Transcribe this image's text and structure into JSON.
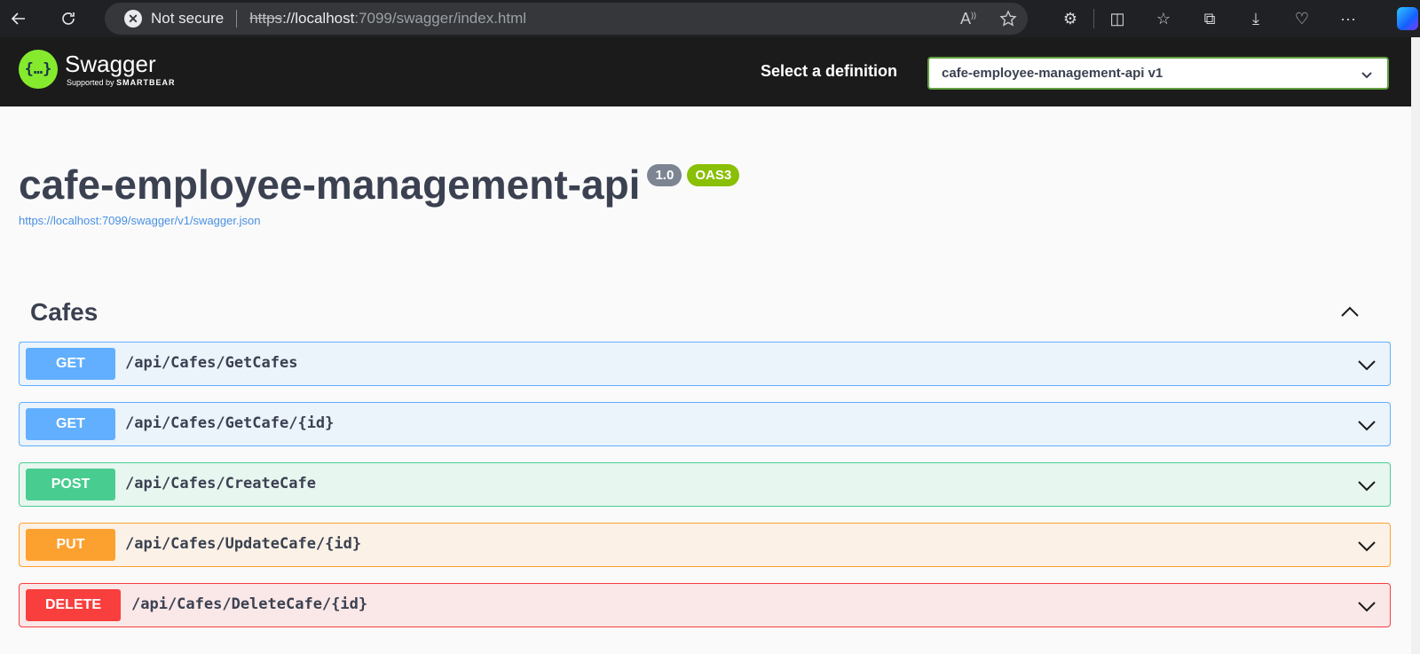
{
  "browser": {
    "security_label": "Not secure",
    "url_scheme": "https",
    "url_host": "://localhost",
    "url_rest": ":7099/swagger/index.html"
  },
  "topbar": {
    "logo_title": "Swagger",
    "logo_supported": "Supported by",
    "logo_brand": "SMARTBEAR",
    "definition_label": "Select a definition",
    "definition_selected": "cafe-employee-management-api v1"
  },
  "info": {
    "title": "cafe-employee-management-api",
    "version": "1.0",
    "oas_badge": "OAS3",
    "spec_url": "https://localhost:7099/swagger/v1/swagger.json"
  },
  "tag": {
    "name": "Cafes"
  },
  "operations": [
    {
      "method": "GET",
      "path": "/api/Cafes/GetCafes"
    },
    {
      "method": "GET",
      "path": "/api/Cafes/GetCafe/{id}"
    },
    {
      "method": "POST",
      "path": "/api/Cafes/CreateCafe"
    },
    {
      "method": "PUT",
      "path": "/api/Cafes/UpdateCafe/{id}"
    },
    {
      "method": "DELETE",
      "path": "/api/Cafes/DeleteCafe/{id}"
    }
  ],
  "colors": {
    "get": "#61affe",
    "post": "#49cc90",
    "put": "#fca130",
    "delete": "#f93e3e",
    "swagger_green": "#85ea2d"
  }
}
